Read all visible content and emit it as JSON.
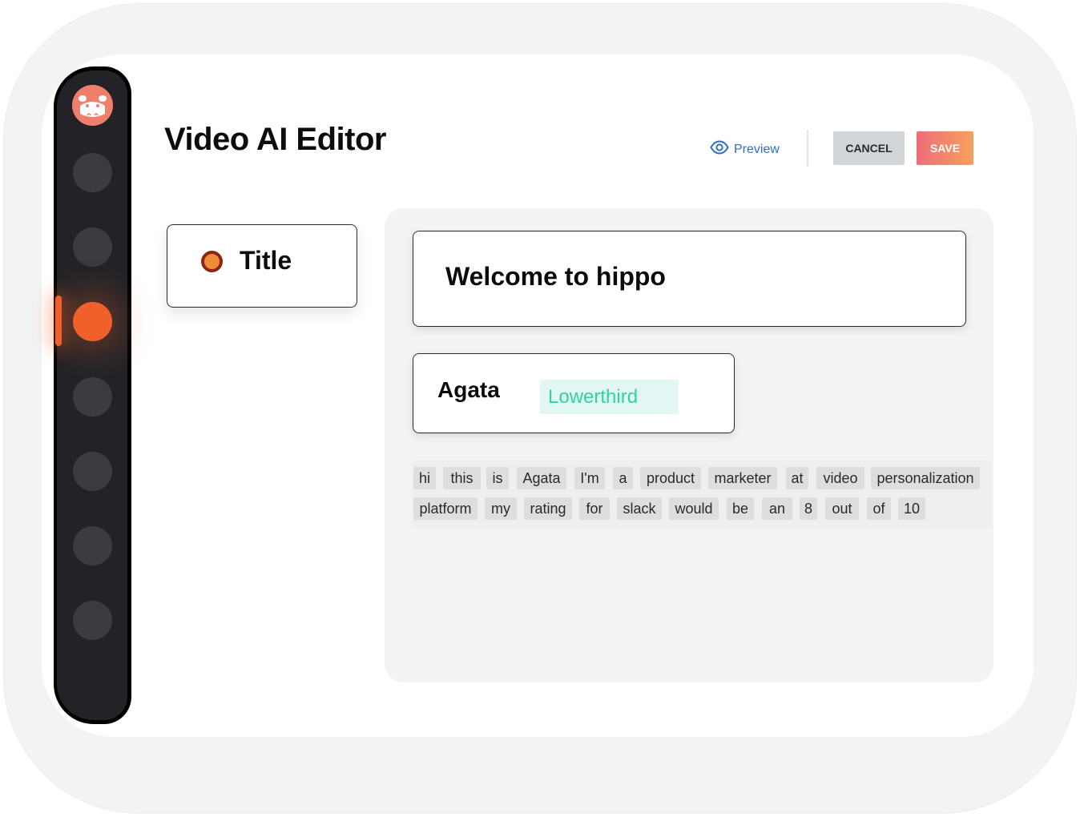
{
  "header": {
    "title": "Video AI Editor",
    "preview_label": "Preview",
    "cancel_label": "CANCEL",
    "save_label": "SAVE"
  },
  "sidebar": {
    "avatar_icon": "hippo-avatar-icon",
    "items_count_note": "",
    "active_index": 2,
    "colors": {
      "bg": "#232327",
      "item": "#3c3b40",
      "active": "#f0602b"
    }
  },
  "segments": {
    "title_card": {
      "label": "Title",
      "dot_color": "#f08b3a"
    },
    "welcome_text": "Welcome to hippo",
    "lowerthird": {
      "name": "Agata",
      "tag": "Lowerthird"
    }
  },
  "transcript": {
    "words": [
      "hi",
      "this",
      "is",
      "Agata",
      "I'm",
      "a",
      "product",
      "marketer",
      "at",
      "video",
      "personalization",
      "platform",
      "my",
      "rating",
      "for",
      "slack",
      "would",
      "be",
      "an",
      "8",
      "out",
      "of",
      "10"
    ]
  },
  "colors": {
    "accent": "#f0602b",
    "preview_link": "#2f6fbf",
    "save_gradient_start": "#ef6c78",
    "save_gradient_end": "#f4a15d",
    "lowerthird_text": "#2fd1a6"
  }
}
